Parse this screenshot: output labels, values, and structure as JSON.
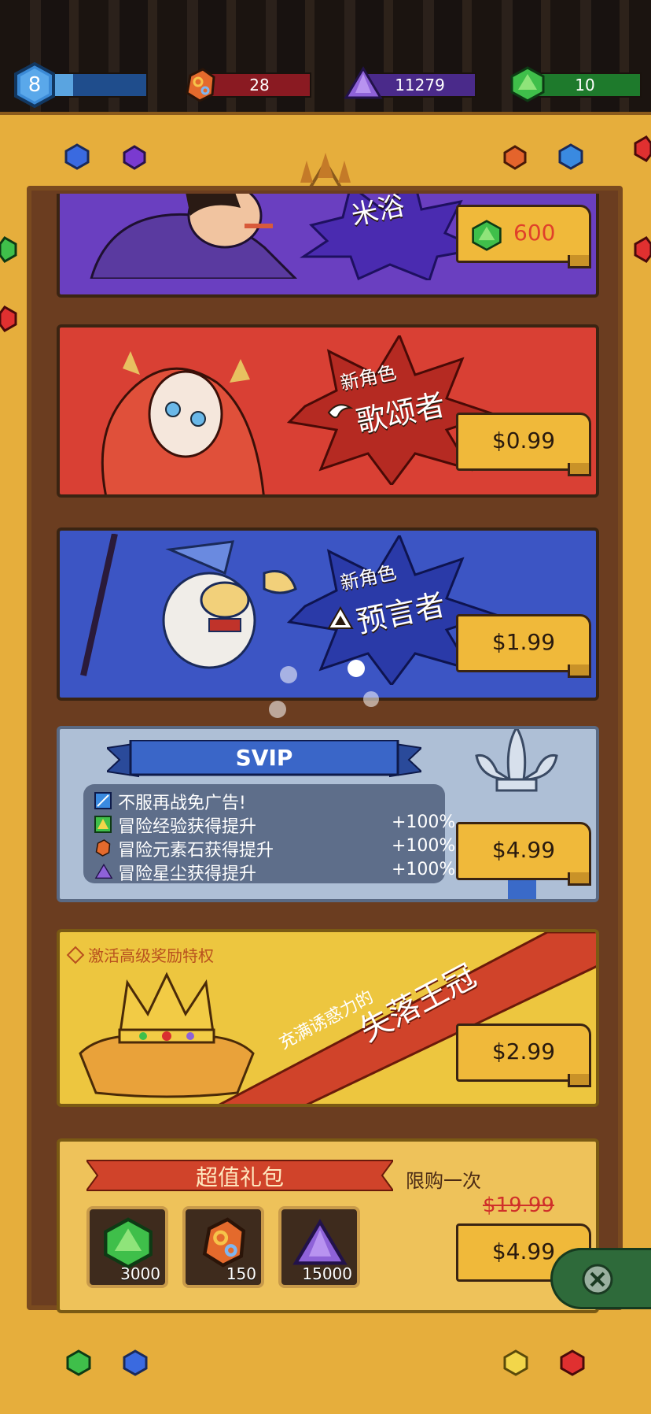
{
  "resources": {
    "level": "8",
    "level_progress": 0.25,
    "ore": "28",
    "stardust": "11279",
    "gems": "10"
  },
  "shop": {
    "top_card": {
      "price": "600",
      "splash_text": "米浴"
    },
    "singer": {
      "tag": "新角色",
      "name": "歌颂者",
      "price": "$0.99"
    },
    "prophet": {
      "tag": "新角色",
      "name": "预言者",
      "price": "$1.99"
    },
    "svip": {
      "title": "SVIP",
      "price": "$4.99",
      "benefits": [
        {
          "label": "不服再战免广告!",
          "value": ""
        },
        {
          "label": "冒险经验获得提升",
          "value": "+100%"
        },
        {
          "label": "冒险元素石获得提升",
          "value": "+100%"
        },
        {
          "label": "冒险星尘获得提升",
          "value": "+100%"
        }
      ]
    },
    "crown": {
      "note": "激活高级奖励特权",
      "subtitle": "充满诱惑力的",
      "title": "失落王冠",
      "price": "$2.99"
    },
    "bundle": {
      "title": "超值礼包",
      "limit": "限购一次",
      "old_price": "$19.99",
      "price": "$4.99",
      "items": [
        {
          "icon": "green-gem-icon",
          "count": "3000"
        },
        {
          "icon": "ore-icon",
          "count": "150"
        },
        {
          "icon": "stardust-icon",
          "count": "15000"
        }
      ]
    }
  },
  "colors": {
    "frame": "#e6ae3c",
    "price_tag": "#f0b93a",
    "purple_card": "#6a3fc0",
    "red_card": "#d94034",
    "blue_card": "#3c55c4",
    "svip_card": "#aebfd6",
    "crown_card": "#edc63f"
  }
}
